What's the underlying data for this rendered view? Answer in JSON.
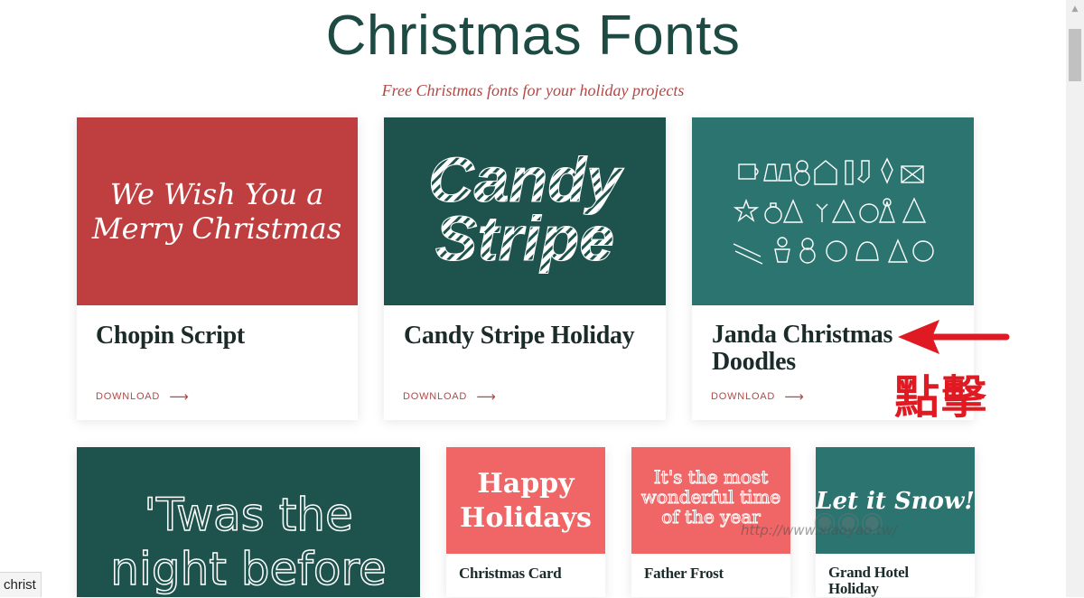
{
  "header": {
    "title": "Christmas Fonts",
    "subtitle": "Free Christmas fonts for your holiday projects"
  },
  "colors": {
    "red": "#bf3e3f",
    "dark_teal": "#1e534d",
    "teal": "#2b7470",
    "coral": "#f06565",
    "title_green": "#1d4a42",
    "accent_red": "#b34845",
    "annotation_red": "#e01a22"
  },
  "cards_row1": [
    {
      "name": "Chopin Script",
      "download_label": "DOWNLOAD",
      "preview": [
        "We Wish You a",
        "Merry Christmas"
      ]
    },
    {
      "name": "Candy Stripe Holiday",
      "download_label": "DOWNLOAD",
      "preview": [
        "Candy",
        "Stripe"
      ]
    },
    {
      "name": "Janda Christmas Doodles",
      "download_label": "DOWNLOAD",
      "preview": []
    }
  ],
  "cards_row2": [
    {
      "preview": [
        "'Twas the",
        "night before"
      ]
    },
    {
      "name": "Christmas Card",
      "preview": [
        "Happy",
        "Holidays"
      ]
    },
    {
      "name": "Father Frost",
      "preview": [
        "It's the most",
        "wonderful time",
        "of the year"
      ]
    },
    {
      "name": "Grand Hotel Holiday",
      "preview": [
        "Let it Snow!"
      ]
    }
  ],
  "annotation": {
    "text": "點擊"
  },
  "watermark": {
    "text": "http://www.xiaoyao.tw/"
  },
  "status_bar": {
    "text": "christ"
  }
}
